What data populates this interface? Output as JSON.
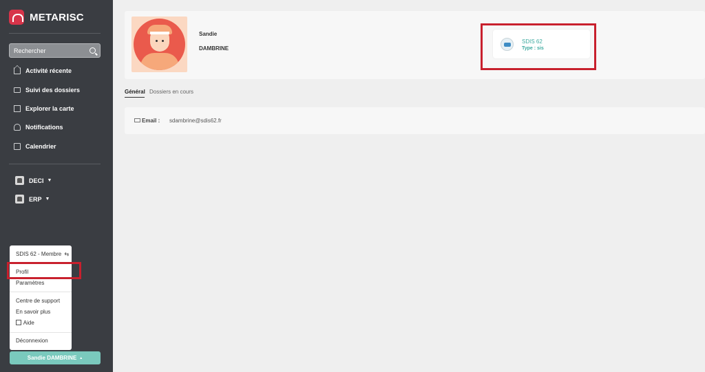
{
  "app": {
    "name": "METARISC"
  },
  "search": {
    "placeholder": "Rechercher"
  },
  "nav": {
    "items": [
      {
        "label": "Activité récente"
      },
      {
        "label": "Suivi des dossiers"
      },
      {
        "label": "Explorer la carte"
      },
      {
        "label": "Notifications"
      },
      {
        "label": "Calendrier"
      }
    ],
    "groups": [
      {
        "label": "DECI"
      },
      {
        "label": "ERP"
      }
    ]
  },
  "menu": {
    "membership": "SDIS 62 - Membre",
    "profile": "Profil",
    "settings": "Paramètres",
    "support": "Centre de support",
    "learn_more": "En savoir plus",
    "help": "Aide",
    "logout": "Déconnexion"
  },
  "user_button": {
    "label": "Sandie DAMBRINE"
  },
  "profile": {
    "first_name": "Sandie",
    "last_name": "DAMBRINE",
    "organization": {
      "name": "SDIS 62",
      "type": "Type : sis"
    }
  },
  "tabs": [
    {
      "label": "Général",
      "active": true
    },
    {
      "label": "Dossiers en cours",
      "active": false
    }
  ],
  "details": {
    "email_label": "Email :",
    "email_value": "sdambrine@sdis62.fr"
  },
  "colors": {
    "sidebar": "#3a3d42",
    "accent": "#7ac9bd",
    "brand": "#d7344a",
    "highlight": "#c8202d",
    "link": "#3eaaa0"
  }
}
